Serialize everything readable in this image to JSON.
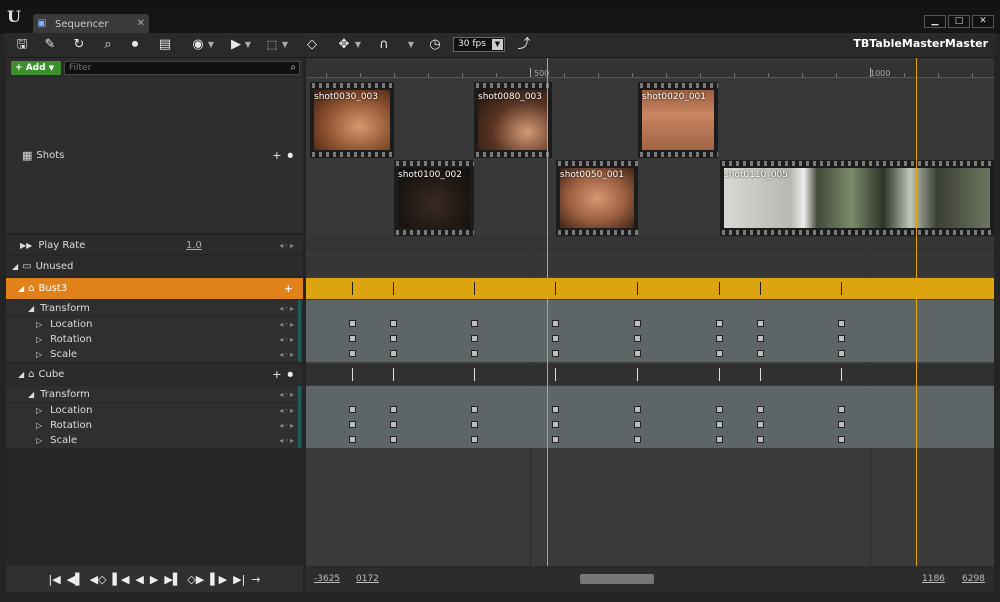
{
  "window": {
    "tab_title": "Sequencer",
    "logo": "U"
  },
  "toolbar": {
    "icons": [
      "save-icon",
      "save-as-icon",
      "refresh-icon",
      "search-icon",
      "camera-icon",
      "clapper-icon",
      "eye-icon",
      "play-icon",
      "selection-icon",
      "key-icon",
      "transform-icon",
      "magnet-icon",
      "clock-icon",
      "curve-icon"
    ],
    "fps": "30 fps",
    "sequence_name": "TBTableMasterMaster"
  },
  "outliner": {
    "add_label": "Add",
    "filter_placeholder": "Filter",
    "shots_label": "Shots",
    "play_rate_label": "Play Rate",
    "play_rate_value": "1.0",
    "unused_label": "Unused",
    "bust_label": "Bust3",
    "cube_label": "Cube",
    "transform_label": "Transform",
    "location_label": "Location",
    "rotation_label": "Rotation",
    "scale_label": "Scale"
  },
  "ruler": {
    "label_500": "500",
    "label_1000": "1000"
  },
  "shots": [
    {
      "name": "shot0030_003"
    },
    {
      "name": "shot0080_003"
    },
    {
      "name": "shot0020_001"
    },
    {
      "name": "shot0100_002"
    },
    {
      "name": "shot0050_001"
    },
    {
      "name": "shot0110_005"
    }
  ],
  "status": {
    "view_start": "-3625",
    "range_start": "0172",
    "range_end": "1186",
    "view_end": "6298"
  },
  "colors": {
    "accent": "#e0811a",
    "playhead": "#e2a200",
    "track_orange": "#dba410",
    "add_green": "#3c8f2c"
  }
}
